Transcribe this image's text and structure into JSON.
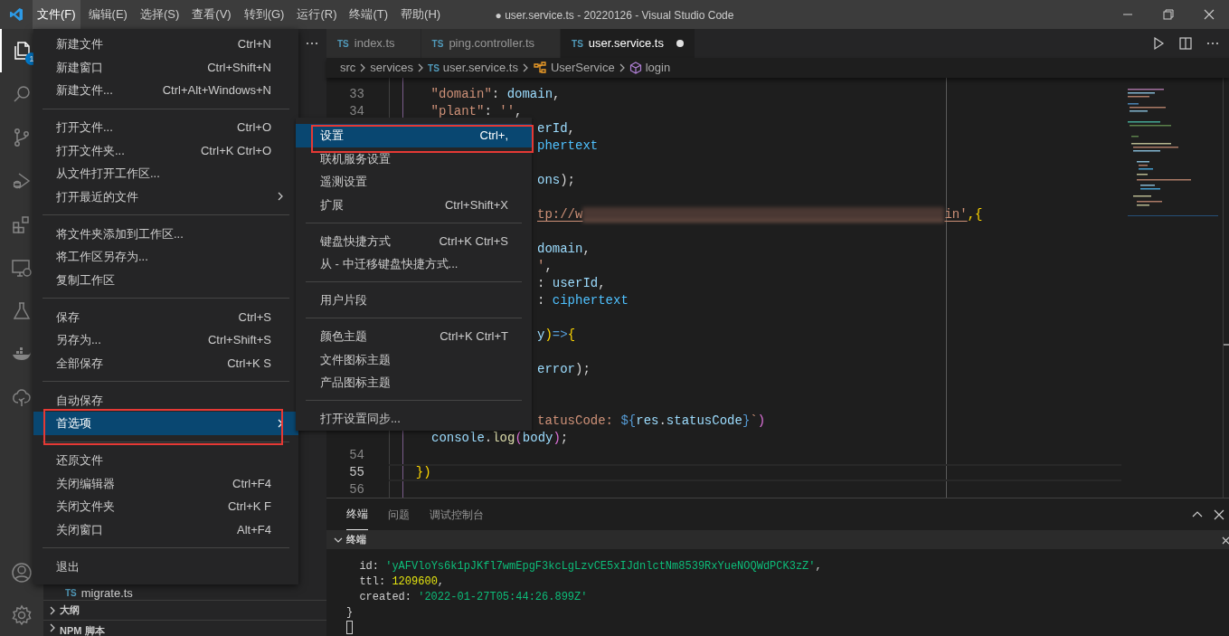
{
  "title_bar": {
    "menus": [
      {
        "label": "文件(F)",
        "selected": true
      },
      {
        "label": "编辑(E)",
        "selected": false
      },
      {
        "label": "选择(S)",
        "selected": false
      },
      {
        "label": "查看(V)",
        "selected": false
      },
      {
        "label": "转到(G)",
        "selected": false
      },
      {
        "label": "运行(R)",
        "selected": false
      },
      {
        "label": "终端(T)",
        "selected": false
      },
      {
        "label": "帮助(H)",
        "selected": false
      }
    ],
    "title": "● user.service.ts - 20220126 - Visual Studio Code"
  },
  "activity_bar": {
    "explorer_badge": "1"
  },
  "sidebar": {
    "files": [
      {
        "badge": "TS",
        "label": "migrate.ts"
      }
    ],
    "sections": [
      {
        "label": "大纲",
        "expanded": false
      },
      {
        "label": "NPM 脚本",
        "expanded": false
      }
    ]
  },
  "editor": {
    "tabs": [
      {
        "badge": "TS",
        "label": "index.ts",
        "selected": false,
        "dirty": false
      },
      {
        "badge": "TS",
        "label": "ping.controller.ts",
        "selected": false,
        "dirty": false
      },
      {
        "badge": "TS",
        "label": "user.service.ts",
        "selected": true,
        "dirty": true
      }
    ],
    "breadcrumb": [
      {
        "kind": "folder",
        "label": "src"
      },
      {
        "kind": "folder",
        "label": "services"
      },
      {
        "kind": "file",
        "badge": "TS",
        "label": "user.service.ts"
      },
      {
        "kind": "class",
        "label": "UserService"
      },
      {
        "kind": "method",
        "label": "login"
      }
    ],
    "lines": [
      {
        "kind": "code",
        "number": "33",
        "current": false,
        "segments": [
          {
            "kind": "string",
            "text": "    \"domain\""
          },
          {
            "kind": "plain",
            "text": ": "
          },
          {
            "kind": "variable",
            "text": "domain"
          },
          {
            "kind": "plain",
            "text": ","
          }
        ]
      },
      {
        "kind": "code",
        "number": "34",
        "current": false,
        "segments": [
          {
            "kind": "string",
            "text": "    \"plant\""
          },
          {
            "kind": "plain",
            "text": ": "
          },
          {
            "kind": "string",
            "text": "''"
          },
          {
            "kind": "plain",
            "text": ","
          }
        ]
      },
      {
        "kind": "code",
        "current": false,
        "segments": [
          {
            "kind": "variable",
            "text": "erId"
          },
          {
            "kind": "plain",
            "text": ","
          }
        ]
      },
      {
        "kind": "code",
        "current": false,
        "segments": [
          {
            "kind": "constant",
            "text": "phertext"
          }
        ]
      },
      {
        "kind": "blank"
      },
      {
        "kind": "code",
        "current": false,
        "segments": [
          {
            "kind": "variable",
            "text": "ons"
          },
          {
            "kind": "plain",
            "text": ");"
          }
        ]
      },
      {
        "kind": "blank"
      },
      {
        "kind": "code",
        "current": false,
        "segments": [
          {
            "kind": "string",
            "text": "tp://w",
            "underline": true
          },
          {
            "kind": "redaction"
          },
          {
            "kind": "string",
            "text": "in'",
            "underline": true
          },
          {
            "kind": "bracket",
            "text": ",{"
          }
        ]
      },
      {
        "kind": "blank"
      },
      {
        "kind": "code",
        "current": false,
        "segments": [
          {
            "kind": "variable",
            "text": "domain"
          },
          {
            "kind": "plain",
            "text": ","
          }
        ]
      },
      {
        "kind": "code",
        "current": false,
        "segments": [
          {
            "kind": "string",
            "text": "'"
          },
          {
            "kind": "plain",
            "text": ","
          }
        ]
      },
      {
        "kind": "code",
        "current": false,
        "segments": [
          {
            "kind": "plain",
            "text": ": "
          },
          {
            "kind": "variable",
            "text": "userId"
          },
          {
            "kind": "plain",
            "text": ","
          }
        ]
      },
      {
        "kind": "code",
        "current": false,
        "segments": [
          {
            "kind": "plain",
            "text": ": "
          },
          {
            "kind": "constant",
            "text": "ciphertext"
          }
        ]
      },
      {
        "kind": "blank"
      },
      {
        "kind": "code",
        "current": false,
        "segments": [
          {
            "kind": "variable",
            "text": "y"
          },
          {
            "kind": "bracket",
            "text": ")"
          },
          {
            "kind": "keyword",
            "text": "=>"
          },
          {
            "kind": "bracket",
            "text": "{"
          }
        ]
      },
      {
        "kind": "blank"
      },
      {
        "kind": "code",
        "current": false,
        "segments": [
          {
            "kind": "variable",
            "text": "error"
          },
          {
            "kind": "plain",
            "text": ");"
          }
        ]
      },
      {
        "kind": "blank"
      },
      {
        "kind": "blank"
      },
      {
        "kind": "code",
        "current": false,
        "segments": [
          {
            "kind": "string",
            "text": "tatusCode: "
          },
          {
            "kind": "keyword",
            "text": "${"
          },
          {
            "kind": "variable",
            "text": "res"
          },
          {
            "kind": "plain",
            "text": "."
          },
          {
            "kind": "variable",
            "text": "statusCode"
          },
          {
            "kind": "keyword",
            "text": "}"
          },
          {
            "kind": "string",
            "text": "`"
          },
          {
            "kind": "bracket2",
            "text": ")"
          }
        ]
      },
      {
        "kind": "code",
        "current": false,
        "segments": [
          {
            "kind": "variable",
            "text": "console"
          },
          {
            "kind": "plain",
            "text": "."
          },
          {
            "kind": "function",
            "text": "log"
          },
          {
            "kind": "bracket2",
            "text": "("
          },
          {
            "kind": "variable",
            "text": "body"
          },
          {
            "kind": "bracket2",
            "text": ")"
          },
          {
            "kind": "plain",
            "text": ";"
          }
        ]
      },
      {
        "kind": "code",
        "number": "54",
        "current": false
      },
      {
        "kind": "code",
        "number": "55",
        "current": true,
        "segments": [
          {
            "kind": "bracket",
            "text": "  })"
          }
        ]
      },
      {
        "kind": "code",
        "number": "56",
        "current": false
      }
    ]
  },
  "file_menu": {
    "groups": [
      {
        "items": [
          {
            "label": "新建文件",
            "shortcut": "Ctrl+N",
            "submenu": false,
            "selected": false,
            "highlighted": false
          },
          {
            "label": "新建窗口",
            "shortcut": "Ctrl+Shift+N",
            "submenu": false,
            "selected": false,
            "highlighted": false
          },
          {
            "label": "新建文件...",
            "shortcut": "Ctrl+Alt+Windows+N",
            "submenu": false,
            "selected": false,
            "highlighted": false
          }
        ]
      },
      {
        "items": [
          {
            "label": "打开文件...",
            "shortcut": "Ctrl+O",
            "submenu": false,
            "selected": false,
            "highlighted": false
          },
          {
            "label": "打开文件夹...",
            "shortcut": "Ctrl+K Ctrl+O",
            "submenu": false,
            "selected": false,
            "highlighted": false
          },
          {
            "label": "从文件打开工作区...",
            "submenu": false,
            "selected": false,
            "highlighted": false
          },
          {
            "label": "打开最近的文件",
            "submenu": true,
            "selected": false,
            "highlighted": false
          }
        ]
      },
      {
        "items": [
          {
            "label": "将文件夹添加到工作区...",
            "submenu": false,
            "selected": false,
            "highlighted": false
          },
          {
            "label": "将工作区另存为...",
            "submenu": false,
            "selected": false,
            "highlighted": false
          },
          {
            "label": "复制工作区",
            "submenu": false,
            "selected": false,
            "highlighted": false
          }
        ]
      },
      {
        "items": [
          {
            "label": "保存",
            "shortcut": "Ctrl+S",
            "submenu": false,
            "selected": false,
            "highlighted": false
          },
          {
            "label": "另存为...",
            "shortcut": "Ctrl+Shift+S",
            "submenu": false,
            "selected": false,
            "highlighted": false
          },
          {
            "label": "全部保存",
            "shortcut": "Ctrl+K S",
            "submenu": false,
            "selected": false,
            "highlighted": false
          }
        ]
      },
      {
        "items": [
          {
            "label": "自动保存",
            "submenu": false,
            "selected": false,
            "highlighted": false
          },
          {
            "label": "首选项",
            "submenu": true,
            "selected": true,
            "highlighted": true
          }
        ]
      },
      {
        "items": [
          {
            "label": "还原文件",
            "submenu": false,
            "selected": false,
            "highlighted": false
          },
          {
            "label": "关闭编辑器",
            "shortcut": "Ctrl+F4",
            "submenu": false,
            "selected": false,
            "highlighted": false
          },
          {
            "label": "关闭文件夹",
            "shortcut": "Ctrl+K F",
            "submenu": false,
            "selected": false,
            "highlighted": false
          },
          {
            "label": "关闭窗口",
            "shortcut": "Alt+F4",
            "submenu": false,
            "selected": false,
            "highlighted": false
          }
        ]
      },
      {
        "items": [
          {
            "label": "退出",
            "submenu": false,
            "selected": false,
            "highlighted": false
          }
        ]
      }
    ]
  },
  "preferences_menu": {
    "groups": [
      {
        "items": [
          {
            "label": "设置",
            "shortcut": "Ctrl+,",
            "selected": true,
            "highlighted": true
          },
          {
            "label": "联机服务设置",
            "selected": false,
            "highlighted": false
          },
          {
            "label": "遥测设置",
            "selected": false,
            "highlighted": false
          },
          {
            "label": "扩展",
            "shortcut": "Ctrl+Shift+X",
            "selected": false,
            "highlighted": false
          }
        ]
      },
      {
        "items": [
          {
            "label": "键盘快捷方式",
            "shortcut": "Ctrl+K Ctrl+S",
            "selected": false,
            "highlighted": false
          },
          {
            "label": "从 - 中迁移键盘快捷方式...",
            "selected": false,
            "highlighted": false
          }
        ]
      },
      {
        "items": [
          {
            "label": "用户片段",
            "selected": false,
            "highlighted": false
          }
        ]
      },
      {
        "items": [
          {
            "label": "颜色主题",
            "shortcut": "Ctrl+K Ctrl+T",
            "selected": false,
            "highlighted": false
          },
          {
            "label": "文件图标主题",
            "selected": false,
            "highlighted": false
          },
          {
            "label": "产品图标主题",
            "selected": false,
            "highlighted": false
          }
        ]
      },
      {
        "items": [
          {
            "label": "打开设置同步...",
            "selected": false,
            "highlighted": false
          }
        ]
      }
    ]
  },
  "panel": {
    "tabs": [
      {
        "label": "终端",
        "selected": true
      },
      {
        "label": "问题",
        "selected": false
      },
      {
        "label": "调试控制台",
        "selected": false
      }
    ],
    "section": {
      "label": "终端",
      "expanded": true
    },
    "lines": [
      {
        "segments": [
          {
            "kind": "plain",
            "text": "  id: "
          },
          {
            "kind": "string",
            "text": "'yAFVloYs6k1pJKfl7wmEpgF3kcLgLzvCE5xIJdnlctNm8539RxYueNOQWdPCK3zZ'"
          },
          {
            "kind": "plain",
            "text": ","
          }
        ]
      },
      {
        "segments": [
          {
            "kind": "plain",
            "text": "  ttl: "
          },
          {
            "kind": "number",
            "text": "1209600"
          },
          {
            "kind": "plain",
            "text": ","
          }
        ]
      },
      {
        "segments": [
          {
            "kind": "plain",
            "text": "  created: "
          },
          {
            "kind": "string",
            "text": "'2022-01-27T05:44:26.899Z'"
          }
        ]
      },
      {
        "segments": [
          {
            "kind": "plain",
            "text": "}"
          }
        ]
      }
    ],
    "cursor": true
  }
}
